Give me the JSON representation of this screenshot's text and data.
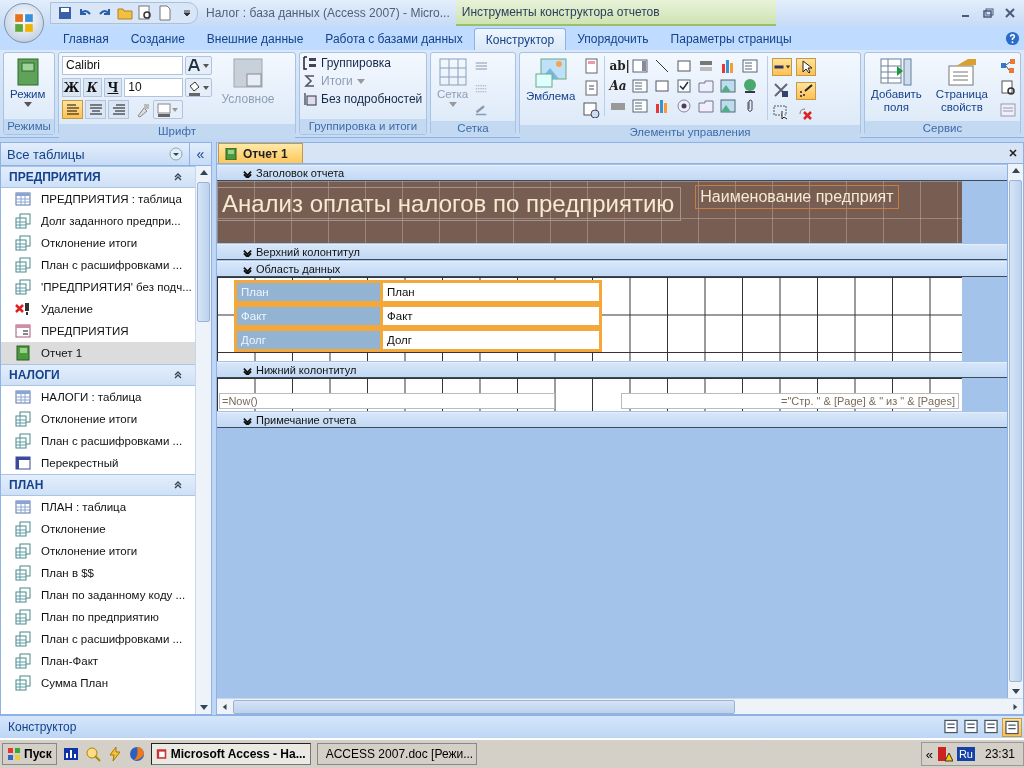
{
  "window": {
    "title": "Налог : база данных (Access 2007) - Micro...",
    "context_title": "Инструменты конструктора отчетов"
  },
  "ribbon_tabs": [
    {
      "label": "Главная",
      "selected": false
    },
    {
      "label": "Создание",
      "selected": false
    },
    {
      "label": "Внешние данные",
      "selected": false
    },
    {
      "label": "Работа с базами данных",
      "selected": false
    },
    {
      "label": "Конструктор",
      "selected": true
    },
    {
      "label": "Упорядочить",
      "selected": false
    },
    {
      "label": "Параметры страницы",
      "selected": false
    }
  ],
  "ribbon": {
    "views": {
      "caption": "Режимы",
      "mode_button": "Режим"
    },
    "font": {
      "caption": "Шрифт",
      "font_name": "Calibri",
      "font_size": "10",
      "bold": "Ж",
      "italic": "К",
      "underline": "Ч",
      "conditional": "Условное",
      "alignment": [
        {
          "kind": "left",
          "selected": true
        },
        {
          "kind": "center",
          "selected": false
        },
        {
          "kind": "right",
          "selected": false
        }
      ]
    },
    "grouping": {
      "caption": "Группировка и итоги",
      "items": [
        {
          "kind": "group",
          "label": "Группировка",
          "disabled": false
        },
        {
          "kind": "totals",
          "label": "Итоги",
          "disabled": true
        },
        {
          "kind": "details",
          "label": "Без подробностей",
          "disabled": false
        }
      ]
    },
    "grid": {
      "caption": "Сетка",
      "grid_button": "Сетка",
      "disabled": true
    },
    "controls": {
      "caption": "Элементы управления",
      "logo_button": "Эмблема",
      "text_box_glyph": "ab|",
      "label_glyph": "Aa",
      "line_width_selected": true,
      "select_selected": true,
      "snap_selected": true
    },
    "tools": {
      "caption": "Сервис",
      "buttons": [
        "Добавить поля",
        "Страница свойств"
      ]
    }
  },
  "navigation": {
    "header": "Все таблицы",
    "collapse": "«",
    "groups": [
      {
        "title": "ПРЕДПРИЯТИЯ",
        "items": [
          {
            "label": "ПРЕДПРИЯТИЯ : таблица",
            "kind": "table",
            "selected": false
          },
          {
            "label": "Долг заданного предпри...",
            "kind": "query",
            "selected": false
          },
          {
            "label": "Отклонение итоги",
            "kind": "query",
            "selected": false
          },
          {
            "label": "План с расшифровками ...",
            "kind": "query",
            "selected": false
          },
          {
            "label": "'ПРЕДПРИЯТИЯ' без подч...",
            "kind": "query",
            "selected": false
          },
          {
            "label": "Удаление",
            "kind": "delete",
            "selected": false
          },
          {
            "label": "ПРЕДПРИЯТИЯ",
            "kind": "form",
            "selected": false
          },
          {
            "label": "Отчет 1",
            "kind": "report",
            "selected": true
          }
        ]
      },
      {
        "title": "НАЛОГИ",
        "items": [
          {
            "label": "НАЛОГИ : таблица",
            "kind": "table",
            "selected": false
          },
          {
            "label": "Отклонение итоги",
            "kind": "query",
            "selected": false
          },
          {
            "label": "План с расшифровками ...",
            "kind": "query",
            "selected": false
          },
          {
            "label": "Перекрестный",
            "kind": "crosstab",
            "selected": false
          }
        ]
      },
      {
        "title": "ПЛАН",
        "items": [
          {
            "label": "ПЛАН : таблица",
            "kind": "table",
            "selected": false
          },
          {
            "label": "Отклонение",
            "kind": "query",
            "selected": false
          },
          {
            "label": "Отклонение итоги",
            "kind": "query",
            "selected": false
          },
          {
            "label": "План в $$",
            "kind": "query",
            "selected": false
          },
          {
            "label": "План по заданному коду ...",
            "kind": "query",
            "selected": false
          },
          {
            "label": "План по предприятию",
            "kind": "query",
            "selected": false
          },
          {
            "label": "План с расшифровками ...",
            "kind": "query",
            "selected": false
          },
          {
            "label": "План-Факт",
            "kind": "query",
            "selected": false
          },
          {
            "label": "Сумма План",
            "kind": "query",
            "selected": false
          }
        ]
      }
    ]
  },
  "document_tab": "Отчет 1",
  "report": {
    "report_header": {
      "band": "Заголовок отчета",
      "title": "Анализ оплаты налогов по предприятию",
      "name_field": "Наименование предприят"
    },
    "page_header": {
      "band": "Верхний колонтитул"
    },
    "detail": {
      "band": "Область данных",
      "selected": true,
      "rows": [
        {
          "label": "План",
          "field": "План"
        },
        {
          "label": "Факт",
          "field": "Факт"
        },
        {
          "label": "Долг",
          "field": "Долг"
        }
      ]
    },
    "page_footer": {
      "band": "Нижний колонтитул",
      "date_field": "=Now()",
      "page_field": "=\"Стр. \" & [Page] & \" из \" & [Pages]"
    },
    "report_footer": {
      "band": "Примечание отчета"
    }
  },
  "status_bar": {
    "text": "Конструктор",
    "views": [
      {
        "selected": false
      },
      {
        "selected": false
      },
      {
        "selected": false
      },
      {
        "selected": true
      }
    ]
  },
  "taskbar": {
    "start": "Пуск",
    "tasks": [
      {
        "label": "Microsoft Access - На...",
        "selected": true
      },
      {
        "label": "ACCESS 2007.doc [Режи...",
        "selected": false
      }
    ],
    "tray_expand": "«",
    "language": "Ru",
    "time": "23:31"
  }
}
